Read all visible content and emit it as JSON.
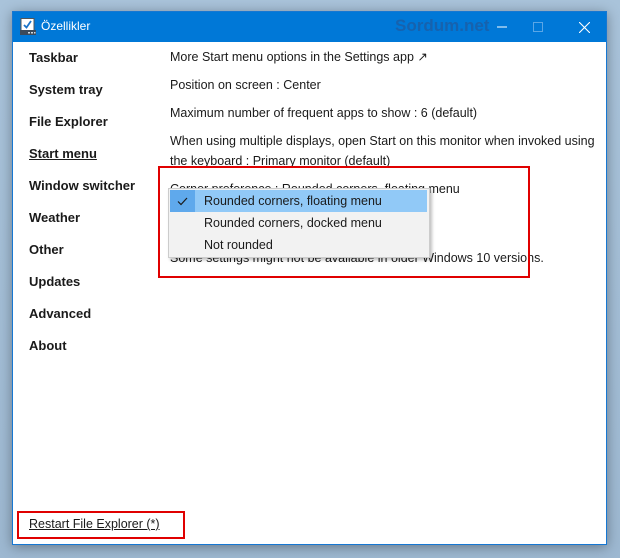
{
  "window": {
    "title": "Özellikler",
    "watermark": "Sordum.net",
    "controls": {
      "minimize_icon": "minimize-icon",
      "maximize_icon": "maximize-icon",
      "close_icon": "close-icon"
    },
    "accent_color": "#0078d7"
  },
  "sidebar": {
    "items": [
      {
        "label": "Taskbar",
        "active": false
      },
      {
        "label": "System tray",
        "active": false
      },
      {
        "label": "File Explorer",
        "active": false
      },
      {
        "label": "Start menu",
        "active": true
      },
      {
        "label": "Window switcher",
        "active": false
      },
      {
        "label": "Weather",
        "active": false
      },
      {
        "label": "Other",
        "active": false
      },
      {
        "label": "Updates",
        "active": false
      },
      {
        "label": "Advanced",
        "active": false
      },
      {
        "label": "About",
        "active": false
      }
    ]
  },
  "content": {
    "settings": [
      {
        "label": "More Start menu options in the Settings app ↗"
      },
      {
        "label": "Position on screen : Center"
      },
      {
        "label": "Maximum number of frequent apps to show : 6 (default)"
      },
      {
        "label": "When using multiple displays, open Start on this monitor when invoked using the keyboard : Primary monitor (default)"
      },
      {
        "label": "Corner preference : Rounded corners, floating menu"
      }
    ],
    "note": "Some settings might not be available in older Windows 10 versions."
  },
  "dropdown": {
    "check_icon": "checkmark-icon",
    "options": [
      {
        "label": "Rounded corners, floating menu",
        "selected": true
      },
      {
        "label": "Rounded corners, docked menu",
        "selected": false
      },
      {
        "label": "Not rounded",
        "selected": false
      }
    ],
    "highlight_color": "#91c9f7"
  },
  "footer": {
    "restart_label": "Restart File Explorer (*)"
  },
  "annotation_color": "#e00000"
}
